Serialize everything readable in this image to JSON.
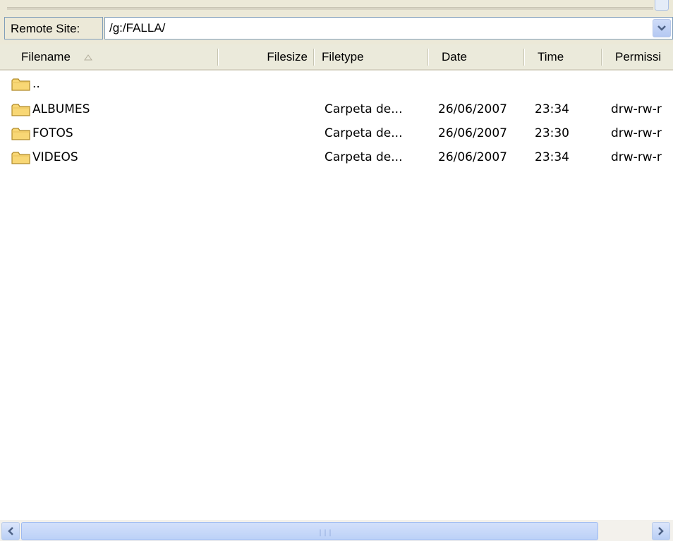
{
  "remote_site": {
    "label": "Remote Site:",
    "path": "/g:/FALLA/"
  },
  "columns": {
    "filename": "Filename",
    "filesize": "Filesize",
    "filetype": "Filetype",
    "date": "Date",
    "time": "Time",
    "permissions": "Permissi"
  },
  "files": [
    {
      "name": "..",
      "size": "",
      "type": "",
      "date": "",
      "time": "",
      "perms": ""
    },
    {
      "name": "ALBUMES",
      "size": "",
      "type": "Carpeta de...",
      "date": "26/06/2007",
      "time": "23:34",
      "perms": "drw-rw-r"
    },
    {
      "name": "FOTOS",
      "size": "",
      "type": "Carpeta de...",
      "date": "26/06/2007",
      "time": "23:30",
      "perms": "drw-rw-r"
    },
    {
      "name": "VIDEOS",
      "size": "",
      "type": "Carpeta de...",
      "date": "26/06/2007",
      "time": "23:34",
      "perms": "drw-rw-r"
    }
  ],
  "scrollbar": {
    "grip": "|||"
  },
  "icons": {
    "folder": "folder-icon",
    "sort": "sort-ascending-icon",
    "dropdown": "chevron-down-icon",
    "left": "chevron-left-icon",
    "right": "chevron-right-icon"
  },
  "colors": {
    "folder_fill": "#f8d775",
    "folder_stroke": "#b08a2a",
    "scroll_blue": "#c1d3f8",
    "border": "#7f9db9"
  }
}
